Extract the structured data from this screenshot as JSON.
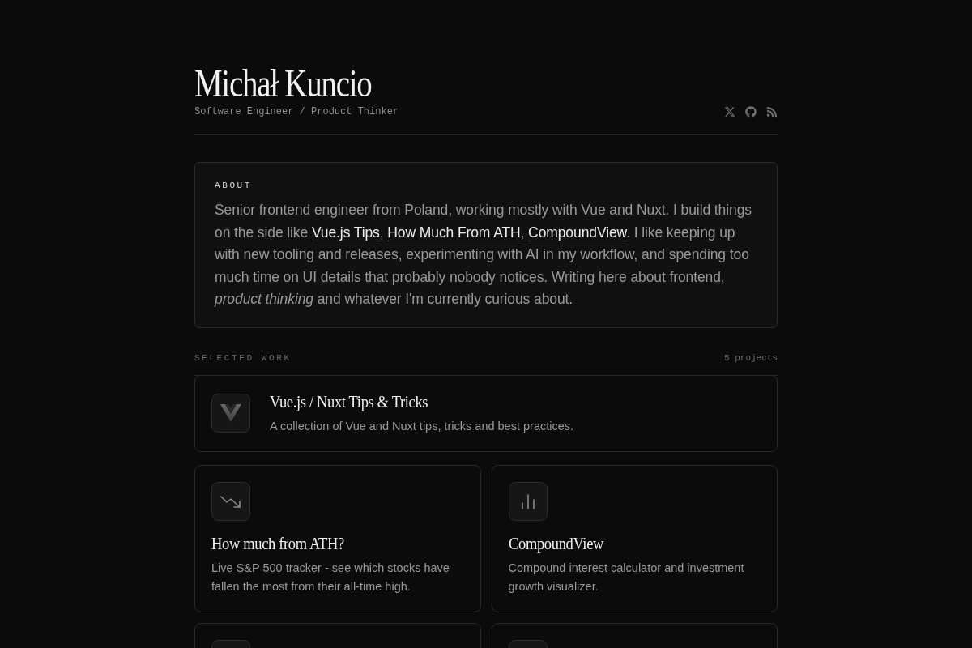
{
  "header": {
    "name": "Michał Kuncio",
    "tagline": "Software Engineer / Product Thinker"
  },
  "about": {
    "label": "ABOUT",
    "paragraph": [
      {
        "kind": "text",
        "text": "Senior frontend engineer from Poland, working mostly with Vue and Nuxt. I build things on the side like "
      },
      {
        "kind": "link",
        "text": "Vue.js Tips"
      },
      {
        "kind": "text",
        "text": ", "
      },
      {
        "kind": "link",
        "text": "How Much From ATH"
      },
      {
        "kind": "text",
        "text": ", "
      },
      {
        "kind": "link",
        "text": "CompoundView"
      },
      {
        "kind": "text",
        "text": ". I like keeping up with new tooling and releases, experimenting with AI in my workflow, and spending too much time on UI details that probably nobody notices. Writing here about frontend, *product thinking* and whatever I'm currently curious about."
      }
    ]
  },
  "work": {
    "label": "SELECTED WORK",
    "count": "5 projects",
    "projects": [
      {
        "kind": "featured",
        "title": "Vue.js / Nuxt Tips & Tricks",
        "description": "A collection of Vue and Nuxt tips, tricks and best practices."
      },
      {
        "kind": "tile",
        "title": "How much from ATH?",
        "description": "Live S&P 500 tracker - see which stocks have fallen the most from their all-time high."
      },
      {
        "kind": "tile",
        "title": "CompoundView",
        "description": "Compound interest calculator and investment growth visualizer."
      },
      {
        "kind": "tile"
      },
      {
        "kind": "tile"
      }
    ]
  }
}
